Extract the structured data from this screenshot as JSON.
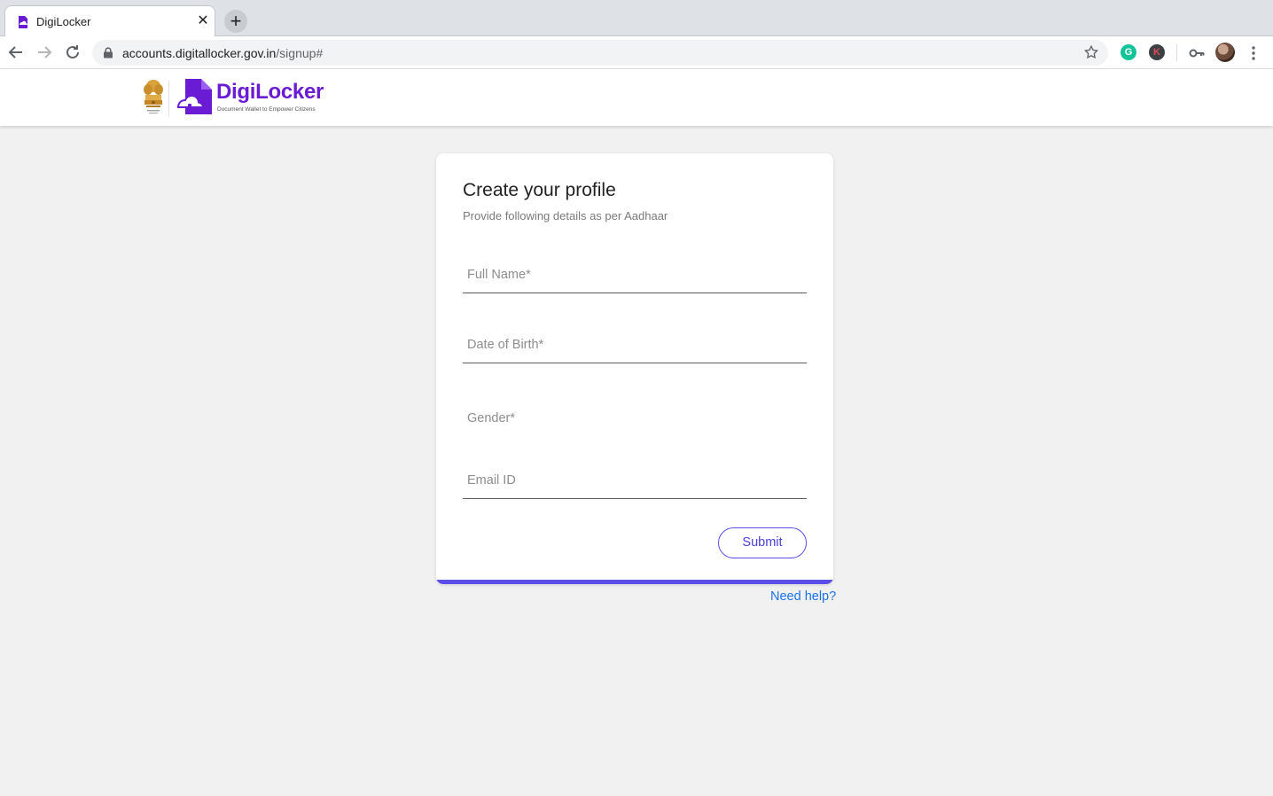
{
  "browser": {
    "tab_title": "DigiLocker",
    "tab_close_glyph": "✕",
    "new_tab_glyph": "+",
    "url_host": "accounts.digitallocker.gov.in",
    "url_path": "/signup#",
    "extension_g_label": "G",
    "extension_k_label": "K"
  },
  "header": {
    "logo_name": "DigiLocker",
    "logo_tagline": "Document Wallet to Empower Citizens",
    "brand_color": "#6a1bd4"
  },
  "form": {
    "title": "Create your profile",
    "subtitle": "Provide following details as per Aadhaar",
    "full_name": {
      "value": "",
      "placeholder": "Full Name*"
    },
    "dob": {
      "value": "",
      "placeholder": "Date of Birth*"
    },
    "gender": {
      "value": "",
      "placeholder": "Gender*"
    },
    "email": {
      "value": "",
      "placeholder": "Email ID"
    },
    "submit_label": "Submit",
    "accent_color": "#5b4de7"
  },
  "help_link": "Need help?"
}
